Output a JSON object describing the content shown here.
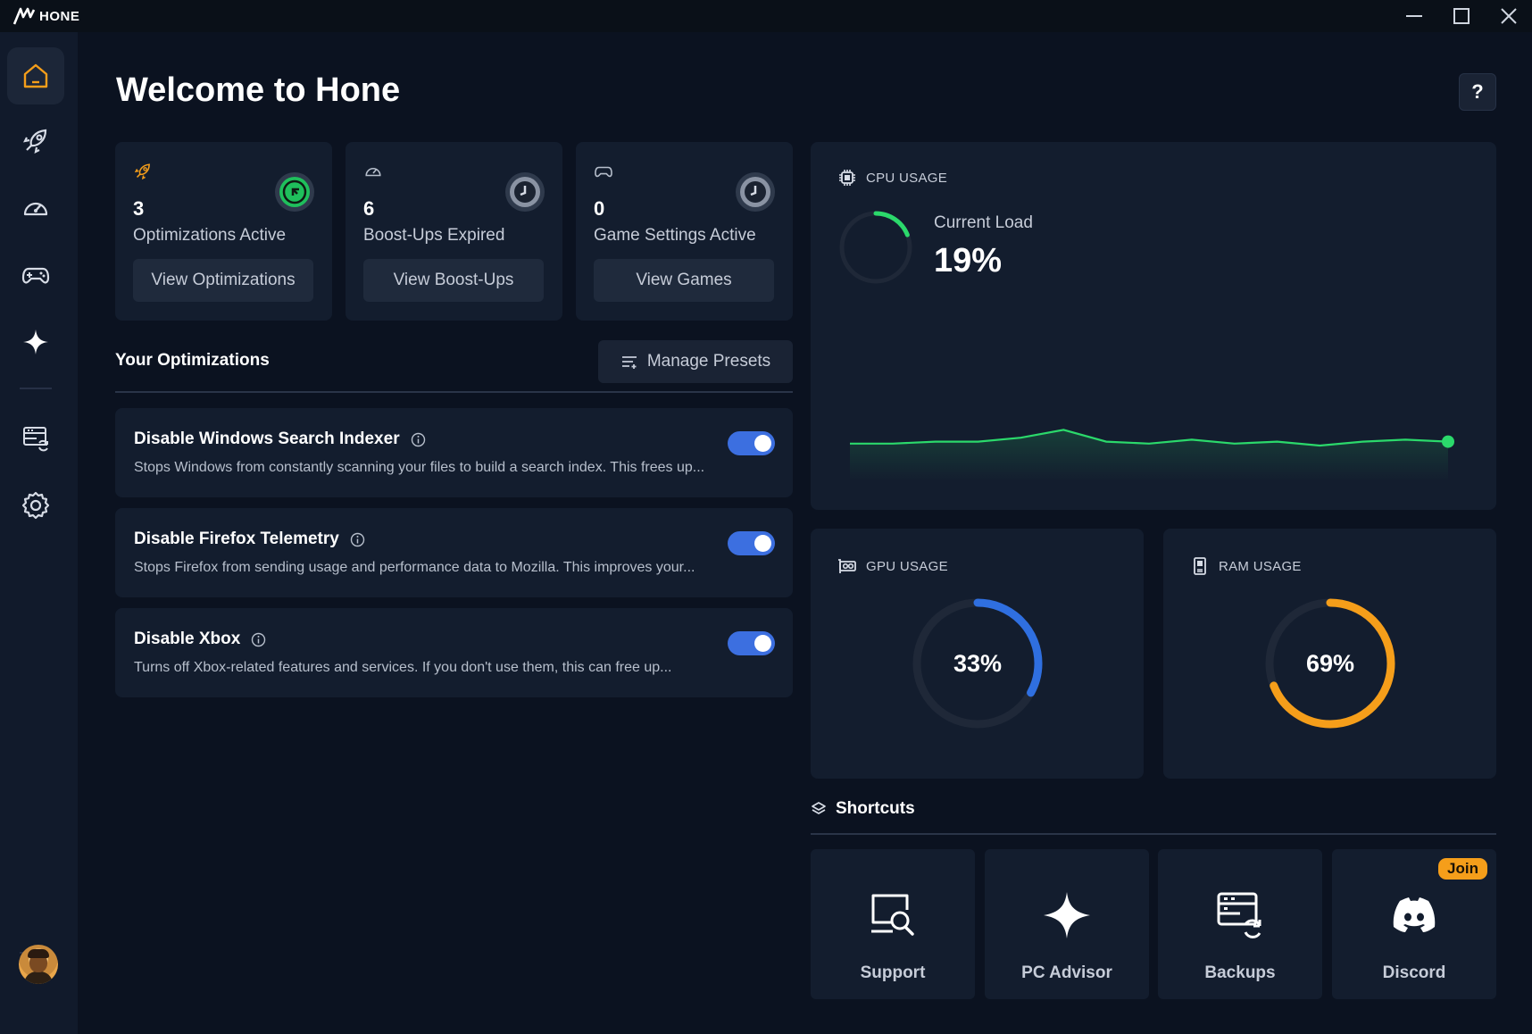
{
  "app": {
    "name": "HONE"
  },
  "page": {
    "title": "Welcome to Hone",
    "help": "?"
  },
  "stats": [
    {
      "value": "3",
      "label": "Optimizations Active",
      "button": "View Optimizations"
    },
    {
      "value": "6",
      "label": "Boost-Ups Expired",
      "button": "View Boost-Ups"
    },
    {
      "value": "0",
      "label": "Game Settings Active",
      "button": "View Games"
    }
  ],
  "optimizations": {
    "title": "Your Optimizations",
    "manage_label": "Manage Presets",
    "items": [
      {
        "title": "Disable Windows Search Indexer",
        "desc": "Stops Windows from constantly scanning your files to build a search index. This frees up...",
        "enabled": true
      },
      {
        "title": "Disable Firefox Telemetry",
        "desc": "Stops Firefox from sending usage and performance data to Mozilla. This improves your...",
        "enabled": true
      },
      {
        "title": "Disable Xbox",
        "desc": "Turns off Xbox-related features and services. If you don't use them, this can free up...",
        "enabled": true
      }
    ]
  },
  "cpu": {
    "title": "CPU USAGE",
    "load_label": "Current Load",
    "load_value": "19%",
    "load_fraction": 0.19,
    "history": [
      20,
      20,
      21,
      21,
      23,
      27,
      21,
      20,
      22,
      20,
      21,
      19,
      21,
      22,
      21
    ]
  },
  "gpu": {
    "title": "GPU USAGE",
    "value": "33%",
    "fraction": 0.33
  },
  "ram": {
    "title": "RAM USAGE",
    "value": "69%",
    "fraction": 0.69
  },
  "shortcuts": {
    "title": "Shortcuts",
    "items": [
      {
        "label": "Support",
        "icon": "support-icon"
      },
      {
        "label": "PC Advisor",
        "icon": "sparkle-icon"
      },
      {
        "label": "Backups",
        "icon": "backup-icon"
      },
      {
        "label": "Discord",
        "icon": "discord-icon",
        "badge": "Join"
      }
    ]
  },
  "colors": {
    "accent": "#3c6fe0",
    "home": "#f59e1a",
    "green": "#2bd96b",
    "gpu": "#2f6fe0",
    "ram": "#f59e1a"
  }
}
